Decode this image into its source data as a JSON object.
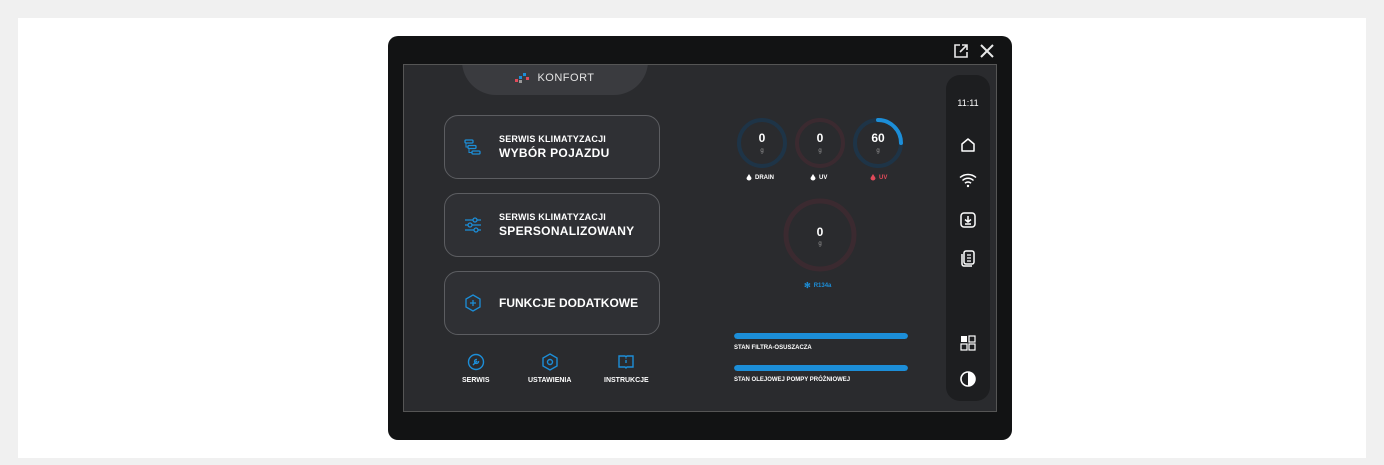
{
  "window": {
    "popout_icon": "external-link-icon",
    "close_icon": "close-icon"
  },
  "brand": {
    "name": "KONFORT"
  },
  "menu": {
    "vehicle": {
      "line1": "SERWIS KLIMATYZACJI",
      "line2": "WYBÓR POJAZDU"
    },
    "custom": {
      "line1": "SERWIS KLIMATYZACJI",
      "line2": "SPERSONALIZOWANY"
    },
    "extra": {
      "label": "FUNKCJE DODATKOWE"
    }
  },
  "bottom_nav": [
    {
      "label": "SERWIS",
      "icon": "wrench-icon"
    },
    {
      "label": "USTAWIENIA",
      "icon": "settings-icon"
    },
    {
      "label": "INSTRUKCJE",
      "icon": "book-icon"
    }
  ],
  "gauges": {
    "drain": {
      "value": "0",
      "unit": "g",
      "label": "DRAIN",
      "level": 0
    },
    "uv1": {
      "value": "0",
      "unit": "g",
      "label": "UV",
      "level": 0
    },
    "uv2": {
      "value": "60",
      "unit": "g",
      "label": "UV",
      "level": 0.25
    },
    "refrigerant": {
      "value": "0",
      "unit": "g",
      "label": "R134a",
      "level": 0
    }
  },
  "status_bars": [
    {
      "label": "STAN FILTRA-OSUSZACZA",
      "level": 1.0
    },
    {
      "label": "STAN OLEJOWEJ POMPY PRÓŻNIOWEJ",
      "level": 1.0
    }
  ],
  "rail": {
    "time": "11:11",
    "icons": [
      "home-icon",
      "wifi-icon",
      "download-icon",
      "documents-icon",
      "grid-icon",
      "contrast-icon"
    ]
  },
  "colors": {
    "accent": "#1c8ed8",
    "danger": "#e04a5a",
    "ring_blue": "#1e3447",
    "ring_red": "#3b2a30"
  }
}
